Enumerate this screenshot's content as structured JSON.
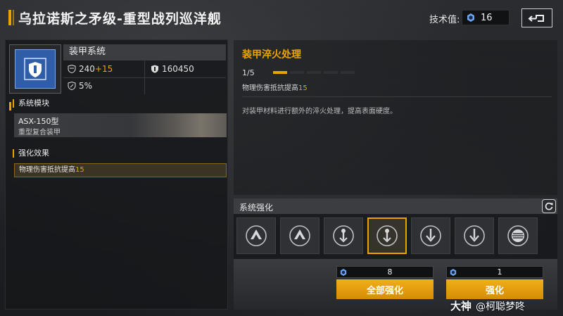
{
  "header": {
    "title": "乌拉诺斯之矛级-重型战列巡洋舰",
    "tech_label": "技术值:",
    "tech_value": "16"
  },
  "system": {
    "name": "装甲系统",
    "stat_armor_base": "240",
    "stat_armor_bonus": "+15",
    "stat_hp": "160450",
    "stat_percent": "5%"
  },
  "module": {
    "section_label": "系统模块",
    "name": "ASX-150型",
    "subtitle": "重型复合装甲"
  },
  "effect": {
    "section_label": "强化效果",
    "text": "物理伤害抵抗提高",
    "value": "15"
  },
  "upgrade": {
    "title": "装甲淬火处理",
    "level": "1/5",
    "progress": 0.2,
    "effect_text": "物理伤害抵抗提高",
    "effect_value": "15",
    "description": "对装甲材料进行额外的淬火处理，提高表面硬度。"
  },
  "enhance": {
    "title": "系统强化",
    "slots": [
      "triangle",
      "triangle",
      "arrow-up",
      "arrow-up",
      "arrow-down",
      "arrow-down",
      "stripes"
    ],
    "selected_index": 3,
    "all_cost": "8",
    "all_label": "全部强化",
    "single_cost": "1",
    "single_label": "强化"
  },
  "watermark": {
    "brand": "大神",
    "handle": "@柯聪梦咚"
  },
  "colors": {
    "accent": "#e9a400",
    "icon_blue": "#2f5da8"
  }
}
